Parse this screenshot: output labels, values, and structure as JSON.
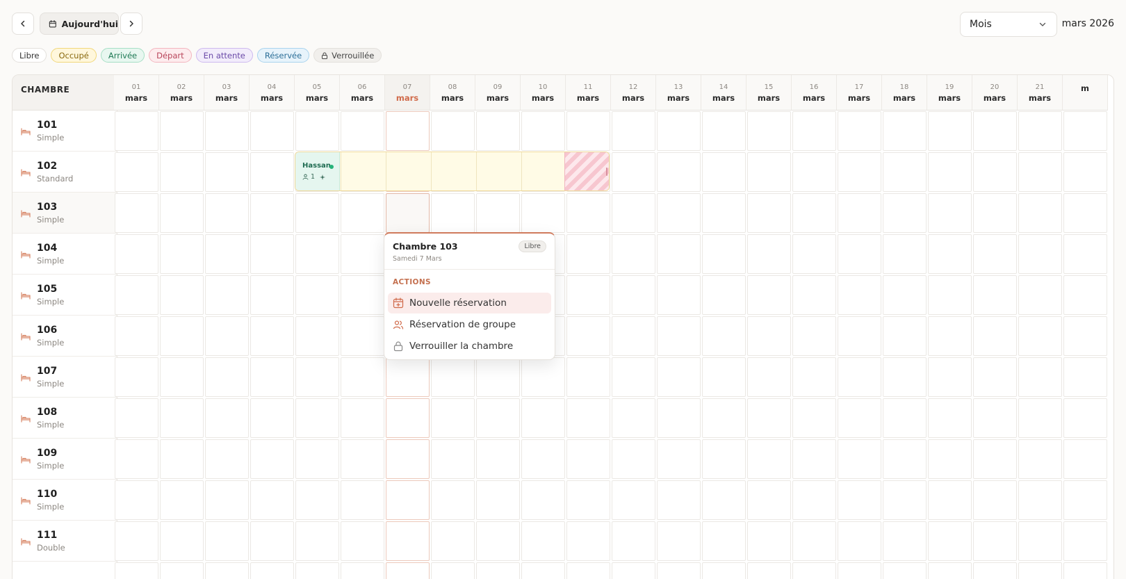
{
  "toolbar": {
    "today_label": "Aujourd'hui",
    "view": "Mois",
    "month": "mars 2026"
  },
  "legend": [
    {
      "label": "Libre",
      "bg": "#ffffff",
      "border": "#e3e0dc",
      "color": "#333333"
    },
    {
      "label": "Occupé",
      "bg": "#fff7dc",
      "border": "#f1d77a",
      "color": "#8a6a10"
    },
    {
      "label": "Arrivée",
      "bg": "#e8f7f0",
      "border": "#a6dfc5",
      "color": "#1f7a55"
    },
    {
      "label": "Départ",
      "bg": "#fdecee",
      "border": "#f3b5bf",
      "color": "#b8445a"
    },
    {
      "label": "En attente",
      "bg": "#f2ecfb",
      "border": "#cdb9ef",
      "color": "#6b4aa8"
    },
    {
      "label": "Réservée",
      "bg": "#e7f3fb",
      "border": "#a9d3ee",
      "color": "#2c6f98"
    },
    {
      "label": "Verrouillée",
      "bg": "#f1efec",
      "border": "#e3e0dc",
      "color": "#444444",
      "icon": "lock-icon"
    }
  ],
  "grid": {
    "room_header": "CHAMBRE",
    "days": [
      {
        "d": "01",
        "m": "mars"
      },
      {
        "d": "02",
        "m": "mars"
      },
      {
        "d": "03",
        "m": "mars"
      },
      {
        "d": "04",
        "m": "mars"
      },
      {
        "d": "05",
        "m": "mars"
      },
      {
        "d": "06",
        "m": "mars"
      },
      {
        "d": "07",
        "m": "mars",
        "today": true
      },
      {
        "d": "08",
        "m": "mars"
      },
      {
        "d": "09",
        "m": "mars"
      },
      {
        "d": "10",
        "m": "mars"
      },
      {
        "d": "11",
        "m": "mars"
      },
      {
        "d": "12",
        "m": "mars"
      },
      {
        "d": "13",
        "m": "mars"
      },
      {
        "d": "14",
        "m": "mars"
      },
      {
        "d": "15",
        "m": "mars"
      },
      {
        "d": "16",
        "m": "mars"
      },
      {
        "d": "17",
        "m": "mars"
      },
      {
        "d": "18",
        "m": "mars"
      },
      {
        "d": "19",
        "m": "mars"
      },
      {
        "d": "20",
        "m": "mars"
      },
      {
        "d": "21",
        "m": "mars"
      },
      {
        "d": "",
        "m": "m"
      }
    ],
    "rooms": [
      {
        "number": "101",
        "type": "Simple"
      },
      {
        "number": "102",
        "type": "Standard"
      },
      {
        "number": "103",
        "type": "Simple"
      },
      {
        "number": "104",
        "type": "Simple"
      },
      {
        "number": "105",
        "type": "Simple"
      },
      {
        "number": "106",
        "type": "Simple"
      },
      {
        "number": "107",
        "type": "Simple"
      },
      {
        "number": "108",
        "type": "Simple"
      },
      {
        "number": "109",
        "type": "Simple"
      },
      {
        "number": "110",
        "type": "Simple"
      },
      {
        "number": "111",
        "type": "Double"
      },
      {
        "number": "",
        "type": ""
      }
    ]
  },
  "booking": {
    "guest": "Hassan",
    "guests_count": "1",
    "room": "102",
    "start_day": "05",
    "end_day": "11"
  },
  "popover": {
    "title": "Chambre 103",
    "badge": "Libre",
    "date": "Samedi 7 Mars",
    "section": "ACTIONS",
    "items": [
      {
        "label": "Nouvelle réservation",
        "icon": "calendar-plus-icon",
        "active": true
      },
      {
        "label": "Réservation de groupe",
        "icon": "users-icon"
      },
      {
        "label": "Verrouiller la chambre",
        "icon": "lock-icon"
      }
    ]
  },
  "colors": {
    "accent": "#d06a4a",
    "occupied_bg": "#fffbe6",
    "arrival_bg": "#e5f6ef",
    "departure_stripe": "#f7c6cf"
  }
}
